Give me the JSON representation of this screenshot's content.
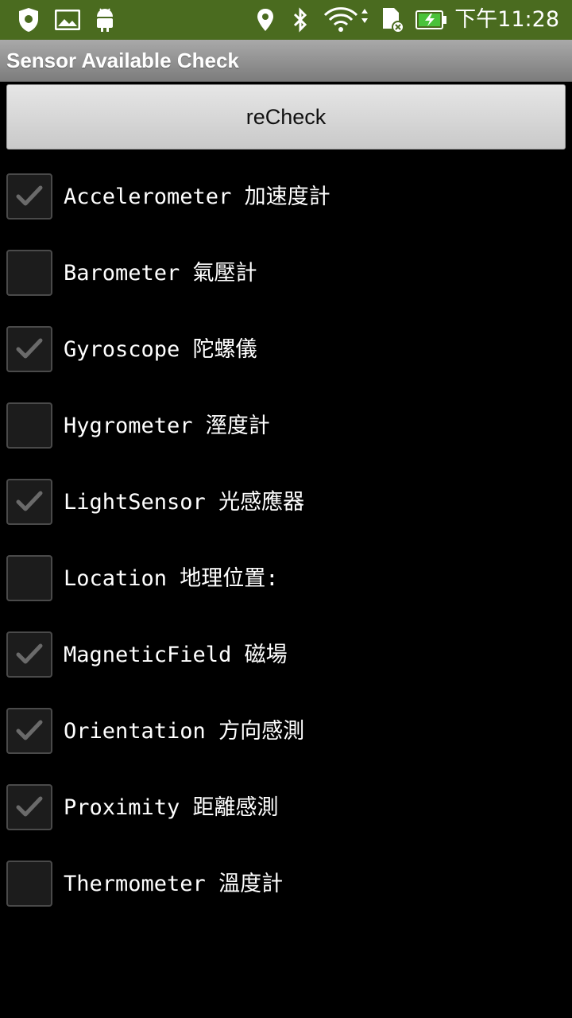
{
  "status_bar": {
    "time": "下午11:28",
    "icons": [
      "shield-icon",
      "image-icon",
      "android-icon",
      "location-icon",
      "bluetooth-icon",
      "wifi-icon",
      "sd-card-icon",
      "battery-charging-icon"
    ],
    "background_color": "#4a6b1f"
  },
  "app": {
    "title": "Sensor Available Check"
  },
  "recheck_button": {
    "label": "reCheck"
  },
  "sensors": [
    {
      "label": "Accelerometer 加速度計",
      "checked": true
    },
    {
      "label": "Barometer 氣壓計",
      "checked": false
    },
    {
      "label": "Gyroscope 陀螺儀",
      "checked": true
    },
    {
      "label": "Hygrometer 溼度計",
      "checked": false
    },
    {
      "label": "LightSensor 光感應器",
      "checked": true
    },
    {
      "label": "Location 地理位置:",
      "checked": false
    },
    {
      "label": "MagneticField 磁場",
      "checked": true
    },
    {
      "label": "Orientation 方向感測",
      "checked": true
    },
    {
      "label": "Proximity 距離感測",
      "checked": true
    },
    {
      "label": "Thermometer 溫度計",
      "checked": false
    }
  ]
}
